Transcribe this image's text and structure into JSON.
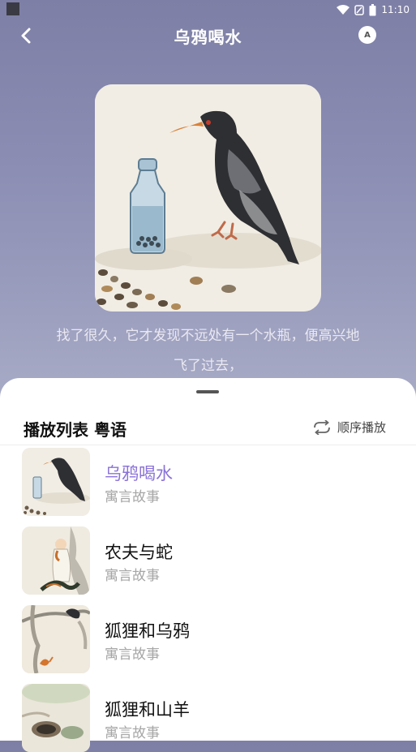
{
  "status": {
    "time": "11:10"
  },
  "header": {
    "title": "乌鸦喝水",
    "ab_label": "A"
  },
  "lyrics": {
    "line1": "找了很久，它才发现不远处有一个水瓶，便高兴地",
    "line2": "飞了过去，"
  },
  "playlist": {
    "title": "播放列表 粤语",
    "order_label": "顺序播放",
    "items": [
      {
        "title": "乌鸦喝水",
        "subtitle": "寓言故事"
      },
      {
        "title": "农夫与蛇",
        "subtitle": "寓言故事"
      },
      {
        "title": "狐狸和乌鸦",
        "subtitle": "寓言故事"
      },
      {
        "title": "狐狸和山羊",
        "subtitle": "寓言故事"
      }
    ]
  },
  "colors": {
    "active_title": "#8a72d8",
    "sheet_bg": "#ffffff"
  }
}
